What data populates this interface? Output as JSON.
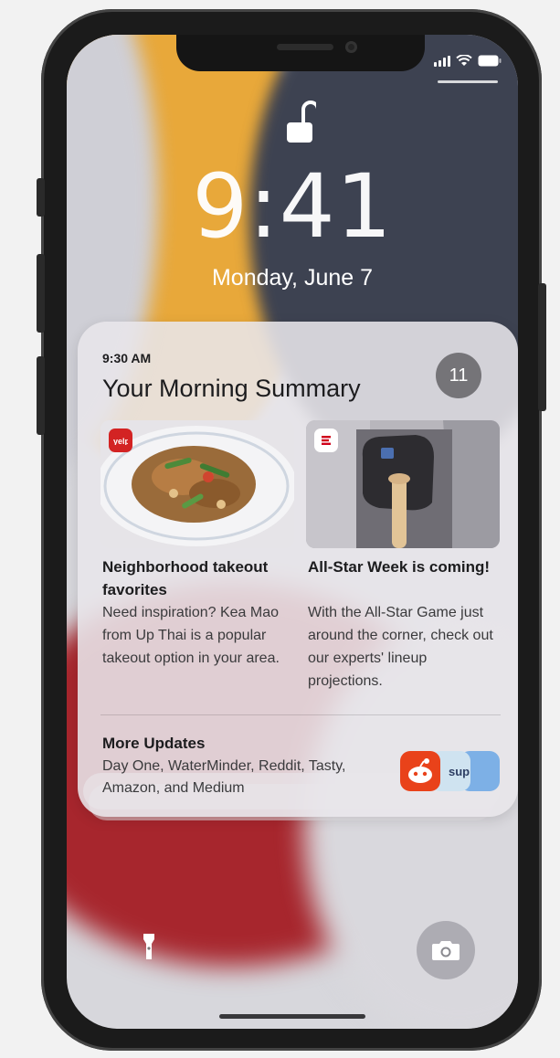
{
  "lock_screen": {
    "time": "9:41",
    "date": "Monday, June 7"
  },
  "summary": {
    "time": "9:30 AM",
    "title": "Your Morning Summary",
    "badge_count": "11",
    "stories": [
      {
        "headline": "Neighborhood takeout favorites",
        "body": "Need inspiration? Kea Mao from Up Thai is a popular takeout option in your area.",
        "app_icon": "yelp-icon",
        "image": "thai-noodle-dish"
      },
      {
        "headline": "All-Star Week is coming!",
        "body": "With the All-Star Game just around the corner, check out our experts' lineup projections.",
        "app_icon": "espn-icon",
        "image": "baseball-player-bat"
      }
    ],
    "more_updates": {
      "heading": "More Updates",
      "body": "Day One, WaterMinder, Reddit, Tasty, Amazon, and Medium"
    }
  },
  "quick_actions": {
    "left": "flashlight-icon",
    "right": "camera-icon"
  },
  "colors": {
    "wallpaper_yellow": "#e9a93a",
    "wallpaper_red": "#a8262c",
    "wallpaper_dark": "#3e4352",
    "card_bg": "#e8e6ea",
    "badge_bg": "#757478"
  }
}
